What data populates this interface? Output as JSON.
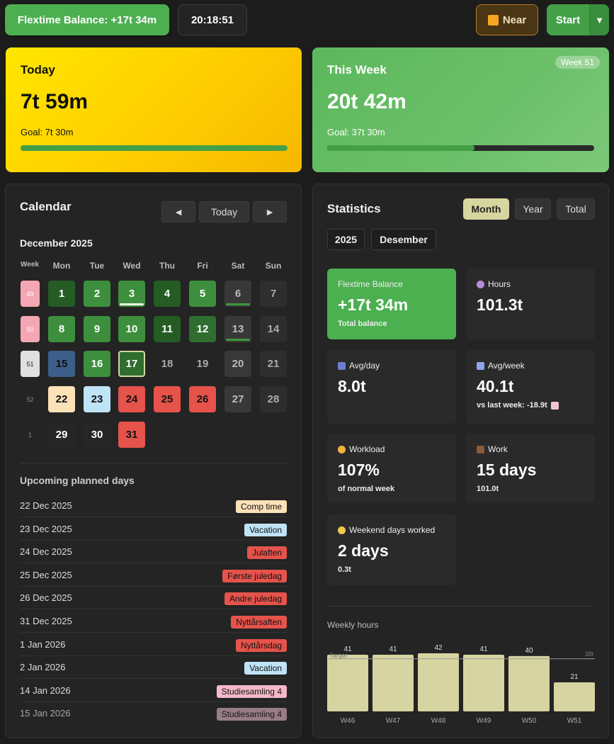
{
  "topbar": {
    "flex_balance": "Flextime Balance: +17t 34m",
    "clock": "20:18:51",
    "near_label": "Near",
    "start_label": "Start",
    "start_dropdown": "▼"
  },
  "today": {
    "title": "Today",
    "value": "7t 59m",
    "goal": "Goal: 7t 30m",
    "progress": 1.0
  },
  "week": {
    "title": "This Week",
    "value": "20t 42m",
    "goal": "Goal: 37t 30m",
    "badge": "Week 51",
    "progress": 0.553
  },
  "calendar": {
    "title": "Calendar",
    "prev": "◄",
    "today_btn": "Today",
    "next": "►",
    "month": "December 2025",
    "headers": [
      "Week",
      "Mon",
      "Tue",
      "Wed",
      "Thu",
      "Fri",
      "Sat",
      "Sun"
    ],
    "weeks": [
      {
        "num": "49",
        "days": [
          "1",
          "2",
          "3",
          "4",
          "5",
          "6",
          "7"
        ]
      },
      {
        "num": "50",
        "days": [
          "8",
          "9",
          "10",
          "11",
          "12",
          "13",
          "14"
        ]
      },
      {
        "num": "51",
        "days": [
          "15",
          "16",
          "17",
          "18",
          "19",
          "20",
          "21"
        ]
      },
      {
        "num": "52",
        "days": [
          "22",
          "23",
          "24",
          "25",
          "26",
          "27",
          "28"
        ]
      },
      {
        "num": "1",
        "days": [
          "29",
          "30",
          "31",
          "",
          "",
          "",
          ""
        ]
      }
    ]
  },
  "upcoming": {
    "title": "Upcoming planned days",
    "items": [
      {
        "date": "22 Dec 2025",
        "tag": "Comp time",
        "color": "#fde2b8"
      },
      {
        "date": "23 Dec 2025",
        "tag": "Vacation",
        "color": "#bfe3f7"
      },
      {
        "date": "24 Dec 2025",
        "tag": "Julaften",
        "color": "#e5534b"
      },
      {
        "date": "25 Dec 2025",
        "tag": "Første juledag",
        "color": "#e5534b"
      },
      {
        "date": "26 Dec 2025",
        "tag": "Andre juledag",
        "color": "#e5534b"
      },
      {
        "date": "31 Dec 2025",
        "tag": "Nyttårsaften",
        "color": "#e5534b"
      },
      {
        "date": "1 Jan 2026",
        "tag": "Nyttårsdag",
        "color": "#e5534b"
      },
      {
        "date": "2 Jan 2026",
        "tag": "Vacation",
        "color": "#bfe3f7"
      },
      {
        "date": "14 Jan 2026",
        "tag": "Studiesamling 4",
        "color": "#f5b8c8"
      },
      {
        "date": "15 Jan 2026",
        "tag": "Studiesamling 4",
        "color": "#c9a3ad"
      }
    ]
  },
  "statistics": {
    "title": "Statistics",
    "tabs": [
      "Month",
      "Year",
      "Total"
    ],
    "active_tab": "Month",
    "year": "2025",
    "month": "Desember",
    "cards": [
      {
        "label": "Flextime Balance",
        "value": "+17t 34m",
        "sub": "Total balance",
        "icon": ""
      },
      {
        "label": "Hours",
        "value": "101.3t",
        "sub": "",
        "icon": "clock-icon"
      },
      {
        "label": "Avg/day",
        "value": "8.0t",
        "sub": "",
        "icon": "bar-chart-icon"
      },
      {
        "label": "Avg/week",
        "value": "40.1t",
        "sub": "vs last week: -18.9t",
        "icon": "calendar-icon"
      },
      {
        "label": "Workload",
        "value": "107%",
        "sub": "of normal week",
        "icon": "flexed-arm-icon"
      },
      {
        "label": "Work",
        "value": "15 days",
        "sub": "101.0t",
        "icon": "briefcase-icon"
      },
      {
        "label": "Weekend days worked",
        "value": "2 days",
        "sub": "0.3t",
        "icon": "moon-icon"
      }
    ],
    "trend_icon": "trend-down-icon"
  },
  "chart_data": {
    "type": "bar",
    "title": "Weekly hours",
    "categories": [
      "W46",
      "W47",
      "W48",
      "W49",
      "W50",
      "W51"
    ],
    "values": [
      41,
      41,
      42,
      41,
      40,
      21
    ],
    "target": 38,
    "target_label": "Target",
    "target_value_label": "38t",
    "ylim": [
      0,
      42
    ],
    "bar_color": "#d6d4a0"
  }
}
